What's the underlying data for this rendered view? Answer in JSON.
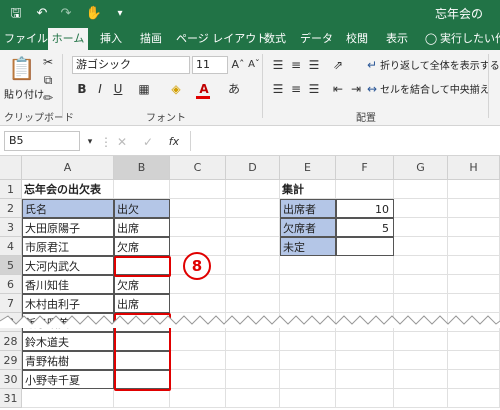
{
  "window": {
    "title": "忘年会の"
  },
  "ribbon_tabs": [
    "ファイル",
    "ホーム",
    "挿入",
    "描画",
    "ページ レイアウト",
    "数式",
    "データ",
    "校閲",
    "表示",
    "実行したい作業"
  ],
  "ribbon": {
    "paste_label": "貼り付け",
    "clipboard_label": "クリップボード",
    "font_name": "游ゴシック",
    "font_size": "11",
    "font_label": "フォント",
    "wrap_text": "折り返して全体を表示する",
    "merge_center": "セルを結合して中央揃え",
    "alignment_label": "配置",
    "bold": "B",
    "italic": "I",
    "underline": "U"
  },
  "formula_bar": {
    "name_box": "B5",
    "fx": "fx"
  },
  "grid": {
    "columns": [
      "A",
      "B",
      "C",
      "D",
      "E",
      "F",
      "G",
      "H"
    ],
    "row_numbers": [
      "1",
      "2",
      "3",
      "4",
      "5",
      "6",
      "7",
      "8",
      "28",
      "29",
      "30",
      "31"
    ],
    "table_title": "忘年会の出欠表",
    "col_header_name": "氏名",
    "col_header_attend": "出欠",
    "names": [
      "大田原陽子",
      "市原君江",
      "大河内武久",
      "香川知佳",
      "木村由利子",
      "飯泉昭美",
      "鈴木道夫",
      "青野祐樹",
      "小野寺千夏"
    ],
    "attendance": [
      "出席",
      "欠席",
      "",
      "欠席",
      "出席",
      "",
      "",
      "",
      ""
    ],
    "summary_title": "集計",
    "summary_labels": [
      "出席者",
      "欠席者",
      "未定"
    ],
    "summary_values": [
      "10",
      "5",
      ""
    ]
  },
  "callout": "8",
  "colors": {
    "excel_green": "#217346",
    "header_blue": "#b4c6e7",
    "highlight_red": "#e00000"
  }
}
